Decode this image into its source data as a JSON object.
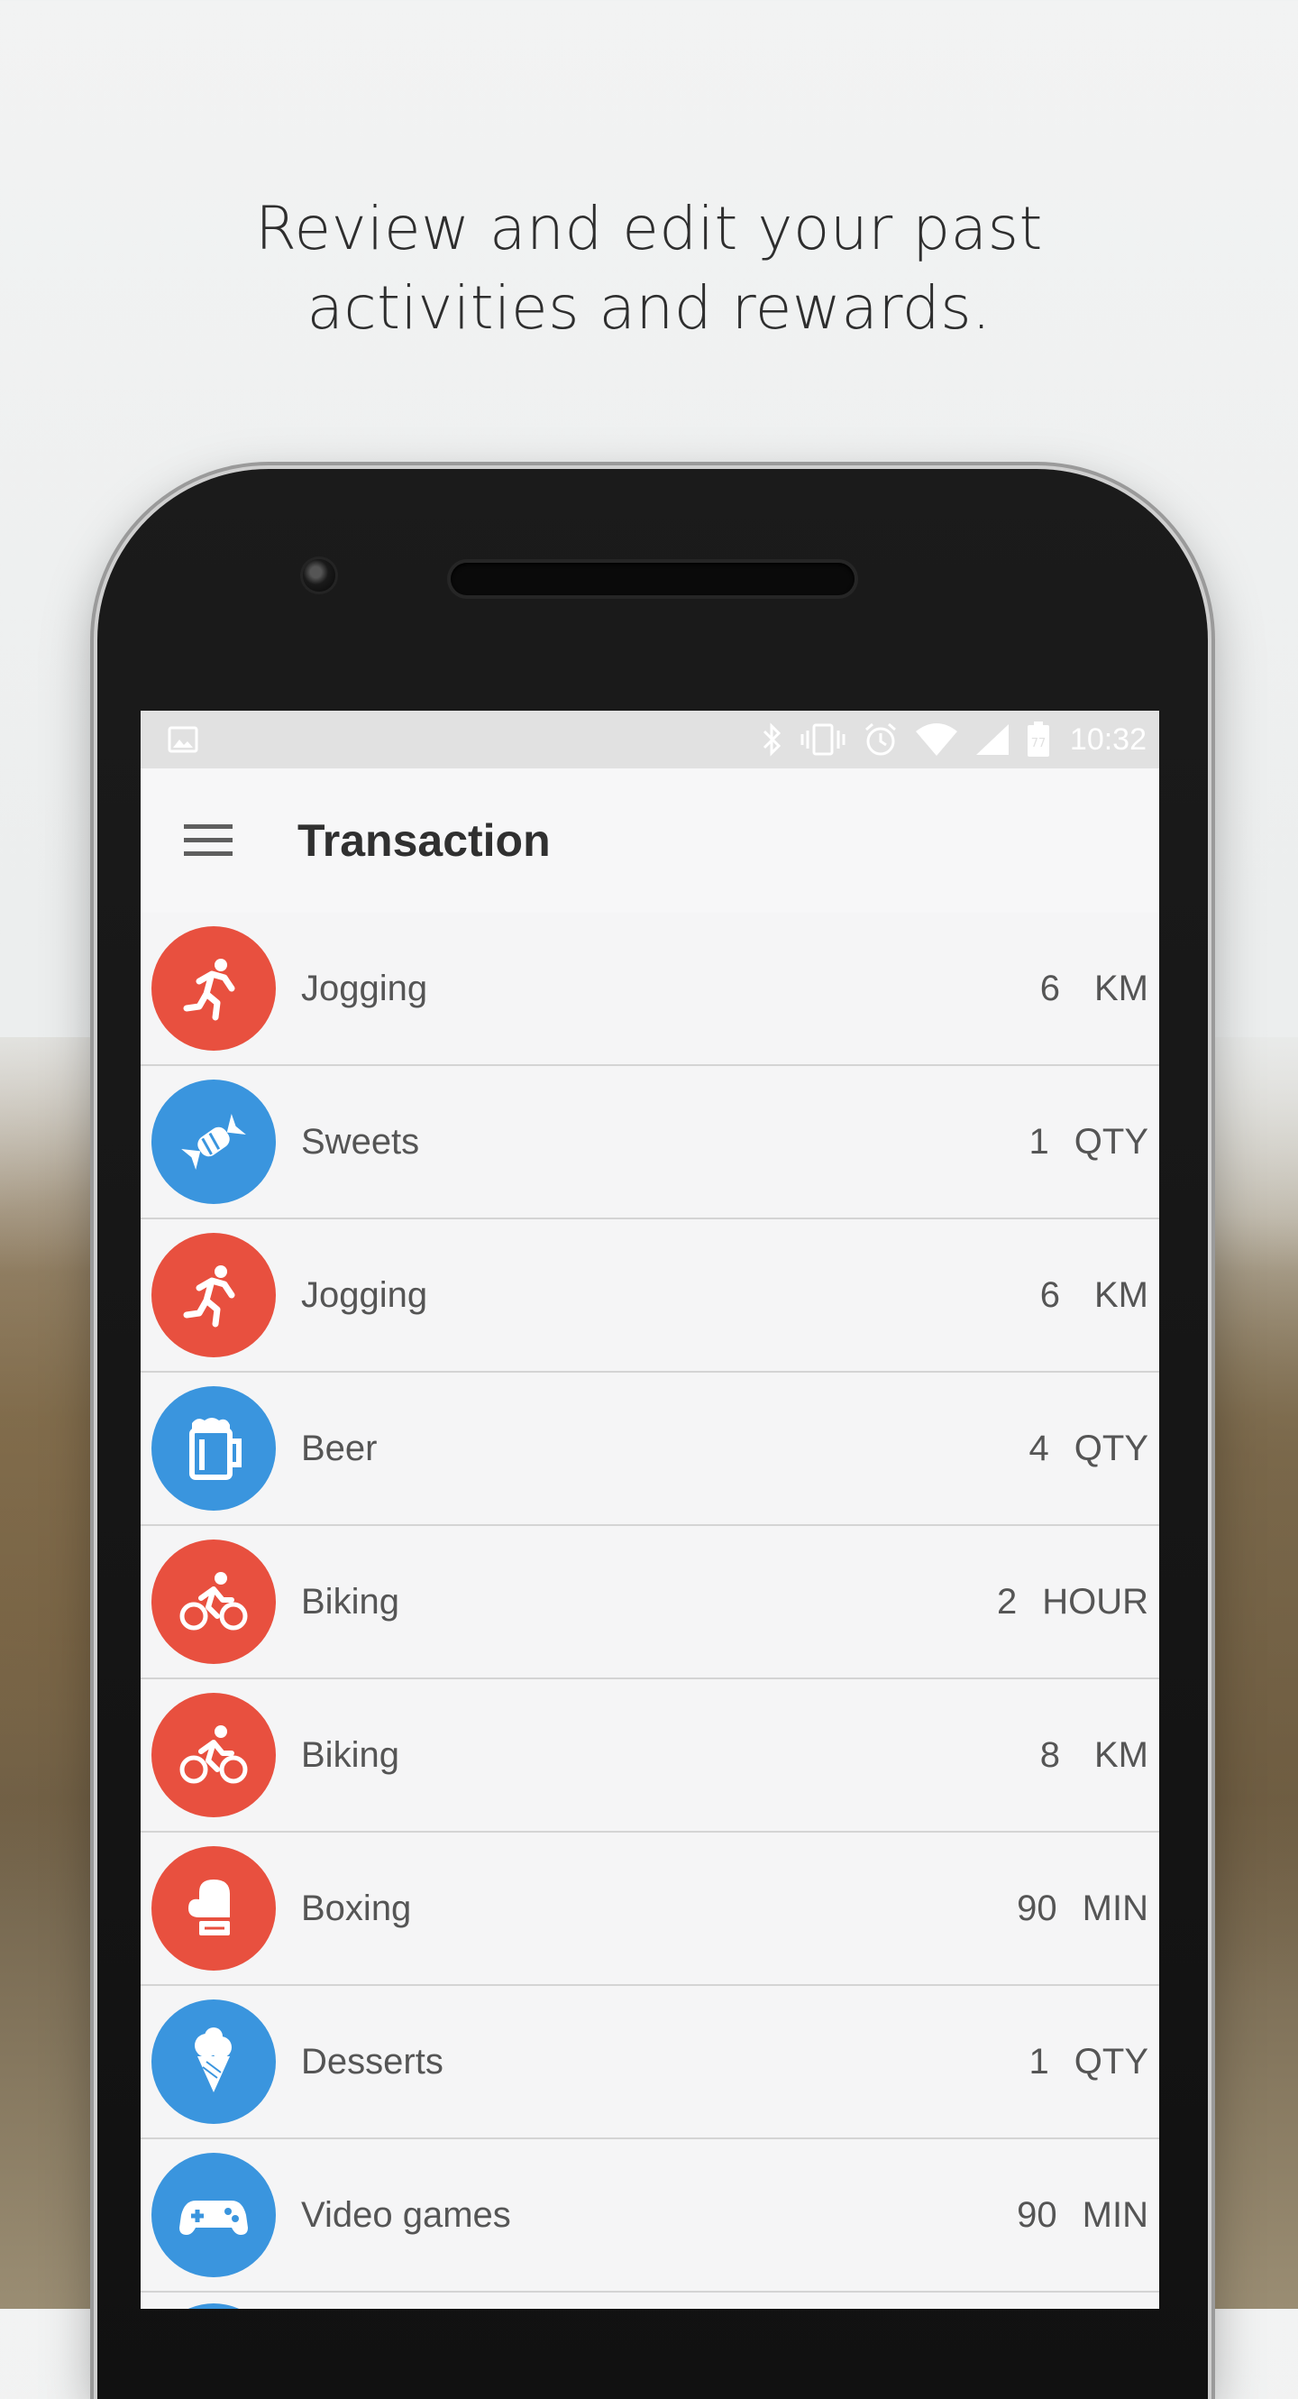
{
  "headline": {
    "line1": "Review and edit your past",
    "line2": "activities and rewards."
  },
  "status_bar": {
    "time": "10:32",
    "battery_level": "77",
    "icons": [
      "image-icon",
      "bluetooth-icon",
      "vibrate-icon",
      "alarm-icon",
      "wifi-icon",
      "signal-icon",
      "battery-icon"
    ]
  },
  "app_bar": {
    "title": "Transaction",
    "menu_icon": "hamburger-menu-icon"
  },
  "colors": {
    "activity": "#e8503f",
    "reward": "#3a95de"
  },
  "transactions": [
    {
      "name": "Jogging",
      "qty": "6",
      "unit": "KM",
      "icon": "running-icon",
      "kind": "activity"
    },
    {
      "name": "Sweets",
      "qty": "1",
      "unit": "QTY",
      "icon": "candy-icon",
      "kind": "reward"
    },
    {
      "name": "Jogging",
      "qty": "6",
      "unit": "KM",
      "icon": "running-icon",
      "kind": "activity"
    },
    {
      "name": "Beer",
      "qty": "4",
      "unit": "QTY",
      "icon": "beer-mug-icon",
      "kind": "reward"
    },
    {
      "name": "Biking",
      "qty": "2",
      "unit": "HOUR",
      "icon": "biking-icon",
      "kind": "activity"
    },
    {
      "name": "Biking",
      "qty": "8",
      "unit": "KM",
      "icon": "biking-icon",
      "kind": "activity"
    },
    {
      "name": "Boxing",
      "qty": "90",
      "unit": "MIN",
      "icon": "boxing-glove-icon",
      "kind": "activity"
    },
    {
      "name": "Desserts",
      "qty": "1",
      "unit": "QTY",
      "icon": "ice-cream-icon",
      "kind": "reward"
    },
    {
      "name": "Video games",
      "qty": "90",
      "unit": "MIN",
      "icon": "gamepad-icon",
      "kind": "reward"
    }
  ]
}
